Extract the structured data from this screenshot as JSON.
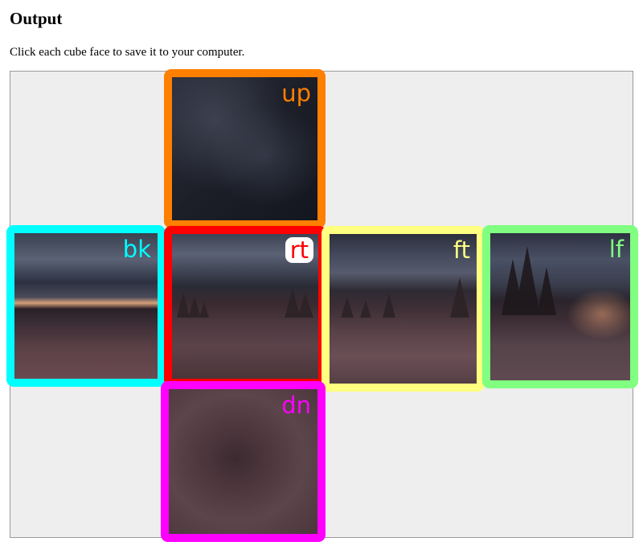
{
  "page": {
    "title": "Output",
    "instructions": "Click each cube face to save it to your computer."
  },
  "faces": {
    "up": {
      "label": "up",
      "border_color": "#ff7f00",
      "label_color": "#ff7f00"
    },
    "bk": {
      "label": "bk",
      "border_color": "#00ffff",
      "label_color": "#00ffff"
    },
    "rt": {
      "label": "rt",
      "border_color": "#ff0000",
      "label_color": "#ff0000"
    },
    "ft": {
      "label": "ft",
      "border_color": "#ffff80",
      "label_color": "#ffff80"
    },
    "lf": {
      "label": "lf",
      "border_color": "#80ff80",
      "label_color": "#80ff80"
    },
    "dn": {
      "label": "dn",
      "border_color": "#ff00ff",
      "label_color": "#ff00ff"
    }
  }
}
